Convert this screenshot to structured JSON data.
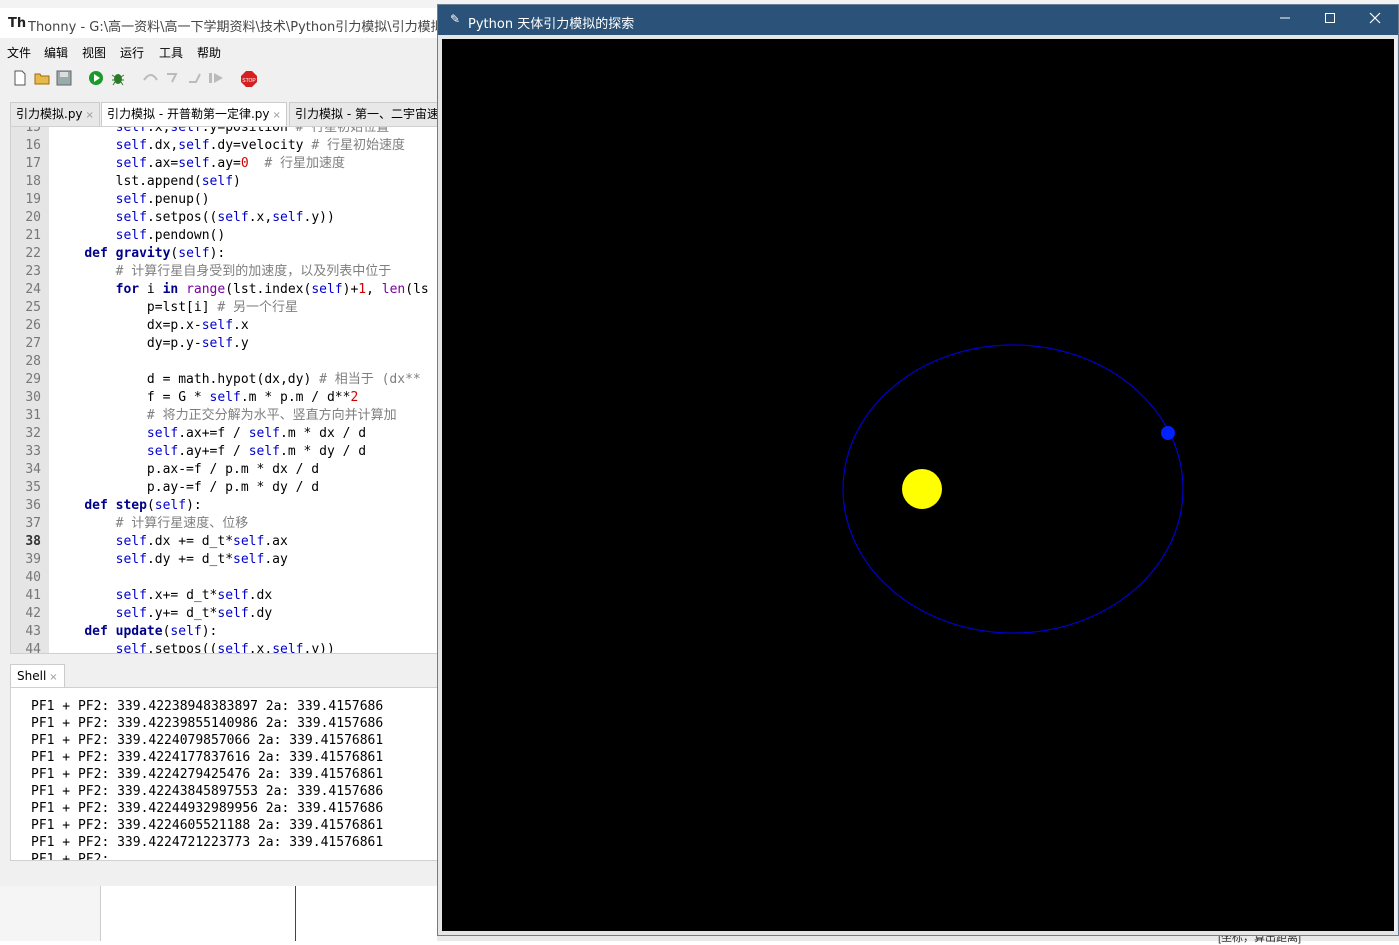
{
  "thonny": {
    "title": "Thonny  -  G:\\高一资料\\高一下学期资料\\技术\\Python引力模拟\\引力模拟  -",
    "logo": "Th",
    "menu": [
      "文件",
      "编辑",
      "视图",
      "运行",
      "工具",
      "帮助"
    ],
    "toolbar_icons": [
      "new-file-icon",
      "open-folder-icon",
      "save-icon",
      "run-icon",
      "debug-icon",
      "step-over-icon",
      "step-into-icon",
      "step-out-icon",
      "resume-icon",
      "stop-icon"
    ],
    "tabs": [
      {
        "label": "引力模拟.py",
        "active": false
      },
      {
        "label": "引力模拟 - 开普勒第一定律.py",
        "active": true
      },
      {
        "label": "引力模拟 - 第一、二宇宙速",
        "active": false
      }
    ],
    "editor": {
      "lines": [
        {
          "n": "15",
          "code": "        self.x,self.y=position # 行星初始位置"
        },
        {
          "n": "16",
          "code": "        self.dx,self.dy=velocity # 行星初始速度"
        },
        {
          "n": "17",
          "code": "        self.ax=self.ay=0  # 行星加速度"
        },
        {
          "n": "18",
          "code": "        lst.append(self)"
        },
        {
          "n": "19",
          "code": "        self.penup()"
        },
        {
          "n": "20",
          "code": "        self.setpos((self.x,self.y))"
        },
        {
          "n": "21",
          "code": "        self.pendown()"
        },
        {
          "n": "22",
          "code": "    def gravity(self):"
        },
        {
          "n": "23",
          "code": "        # 计算行星自身受到的加速度，以及列表中位于"
        },
        {
          "n": "24",
          "code": "        for i in range(lst.index(self)+1, len(ls"
        },
        {
          "n": "25",
          "code": "            p=lst[i] # 另一个行星"
        },
        {
          "n": "26",
          "code": "            dx=p.x-self.x"
        },
        {
          "n": "27",
          "code": "            dy=p.y-self.y"
        },
        {
          "n": "28",
          "code": ""
        },
        {
          "n": "29",
          "code": "            d = math.hypot(dx,dy) # 相当于 (dx**"
        },
        {
          "n": "30",
          "code": "            f = G * self.m * p.m / d**2"
        },
        {
          "n": "31",
          "code": "            # 将力正交分解为水平、竖直方向并计算加"
        },
        {
          "n": "32",
          "code": "            self.ax+=f / self.m * dx / d"
        },
        {
          "n": "33",
          "code": "            self.ay+=f / self.m * dy / d"
        },
        {
          "n": "34",
          "code": "            p.ax-=f / p.m * dx / d"
        },
        {
          "n": "35",
          "code": "            p.ay-=f / p.m * dy / d"
        },
        {
          "n": "36",
          "code": "    def step(self):"
        },
        {
          "n": "37",
          "code": "        # 计算行星速度、位移"
        },
        {
          "n": "38",
          "code": "        self.dx += d_t*self.ax"
        },
        {
          "n": "39",
          "code": "        self.dy += d_t*self.ay"
        },
        {
          "n": "40",
          "code": ""
        },
        {
          "n": "41",
          "code": "        self.x+= d_t*self.dx"
        },
        {
          "n": "42",
          "code": "        self.y+= d_t*self.dy"
        },
        {
          "n": "43",
          "code": "    def update(self):"
        },
        {
          "n": "44",
          "code": "        self.setpos((self.x,self.y))"
        }
      ],
      "current_line": "38"
    },
    "shell": {
      "tab_label": "Shell",
      "lines": [
        "PF1 + PF2: 339.42238948383897 2a: 339.4157686",
        "PF1 + PF2: 339.42239855140986 2a: 339.4157686",
        "PF1 + PF2: 339.4224079857066 2a: 339.41576861",
        "PF1 + PF2: 339.4224177837616 2a: 339.41576861",
        "PF1 + PF2: 339.4224279425476 2a: 339.41576861",
        "PF1 + PF2: 339.42243845897553 2a: 339.4157686",
        "PF1 + PF2: 339.42244932989956 2a: 339.4157686",
        "PF1 + PF2: 339.4224605521188 2a: 339.41576861",
        "PF1 + PF2: 339.4224721223773 2a: 339.41576861",
        "PF1 + PF2:"
      ]
    }
  },
  "turtle_window": {
    "title": "Python 天体引力模拟的探索",
    "controls": [
      "minimize",
      "maximize",
      "close"
    ],
    "colors": {
      "background": "#000000",
      "orbit": "#0000cc",
      "sun": "#ffff00",
      "planet": "#0000ff",
      "titlebar": "#2b5278"
    }
  },
  "background": {
    "bottom_text": "[坐标，算出距离]"
  }
}
